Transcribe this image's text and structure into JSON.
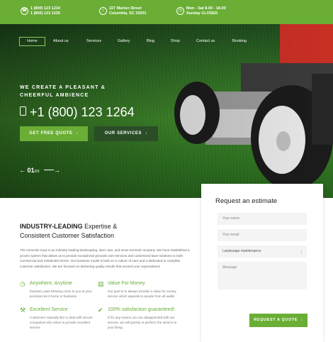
{
  "topbar": {
    "contacts": [
      {
        "icon": "phone-icon",
        "line1": "1 (800) 123 1234",
        "line2": "1 (800) 123 1235"
      },
      {
        "icon": "home-icon",
        "line1": "227 Marion Street",
        "line2": "Columbia, SC 29201"
      },
      {
        "icon": "clock-icon",
        "line1": "Mon - Sat 8.00 - 18.00",
        "line2": "Sunday CLOSED"
      }
    ]
  },
  "nav": {
    "items": [
      "Home",
      "About us",
      "Services",
      "Gallery",
      "Blog",
      "Shop",
      "Contact us",
      "Booking"
    ],
    "active": "Home"
  },
  "hero": {
    "tagline_line1": "WE CREATE A PLEASANT &",
    "tagline_line2": "CHEERFUL AMBIENCE",
    "phone": "+1 (800) 123 1264",
    "primary_button": "GET FREE QUOTE",
    "secondary_button": "OUR SERVICES",
    "slide_current": "01",
    "slide_total": "/03"
  },
  "content": {
    "heading_bold": "INDUSTRY-LEADING",
    "heading_rest1": " Expertise &",
    "heading_line2": "Consistent Customer Satisfaction",
    "paragraph": "The Grounds Guys is an industry leading landscaping, lawn care, and snow removal company. We have established a proven system that allows us to provide exceptional grounds care services and customized lawn solutions to both commercial and residential clients. Our business model is built on a culture of care and a dedicated to complete customer satisfaction. We are focused on delivering quality results that exceed your expectations!",
    "features": [
      {
        "icon": "clock-icon",
        "title": "Anywhere, Anytime",
        "text": "Express Lawn Mowing come to you at your premises be it home or business"
      },
      {
        "icon": "money-icon",
        "title": "Value For Money",
        "text": "Our goal is to always provide a value for money service which appeals to people from all walks"
      },
      {
        "icon": "tools-icon",
        "title": "Excellent Service",
        "text": "Customers naturally like to deal with secure companies who strive to provide excellent service."
      },
      {
        "icon": "thumbs-up-icon",
        "title": "100% satisfaction guaranteed!",
        "text": "If for any reason you are disappointed with our service, we will quickly re-perform the service to your liking."
      }
    ]
  },
  "estimate": {
    "title": "Request an estimate",
    "name_placeholder": "Your name",
    "email_placeholder": "Your email",
    "service_selected": "Landscape maintenance",
    "message_placeholder": "Message",
    "submit": "REQUEST A QUOTE"
  },
  "colors": {
    "accent": "#6aae35",
    "dark_button": "#2a4d26"
  }
}
